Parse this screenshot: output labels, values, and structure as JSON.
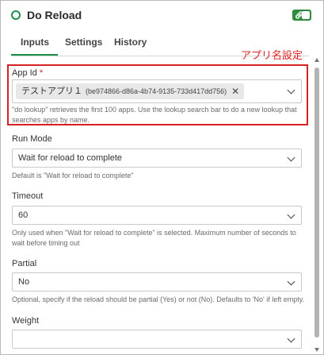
{
  "header": {
    "title": "Do Reload",
    "toggle_icon": "link-icon"
  },
  "tabs": [
    {
      "label": "Inputs",
      "active": true
    },
    {
      "label": "Settings",
      "active": false
    },
    {
      "label": "History",
      "active": false
    }
  ],
  "annotation": "アプリ名設定",
  "fields": {
    "app_id": {
      "label": "App Id",
      "required_mark": "*",
      "chip_name": "テストアプリ１",
      "chip_id": "(be974866-d86a-4b74-9135-733d417dd756)",
      "help": "\"do lookup\" retrieves the first 100 apps. Use the lookup search bar to do a new lookup that searches apps by name."
    },
    "run_mode": {
      "label": "Run Mode",
      "value": "Wait for reload to complete",
      "help": "Default is \"Wait for reload to complete\""
    },
    "timeout": {
      "label": "Timeout",
      "value": "60",
      "help": "Only used when \"Wait for reload to complete\" is selected. Maximum number of seconds to wait before timing out"
    },
    "partial": {
      "label": "Partial",
      "value": "No",
      "help": "Optional, specify if the reload should be partial (Yes) or not (No). Defaults to 'No' if left empty."
    },
    "weight": {
      "label": "Weight",
      "value": ""
    }
  },
  "colors": {
    "accent": "#1a8f4a",
    "annotation": "#d62222"
  }
}
